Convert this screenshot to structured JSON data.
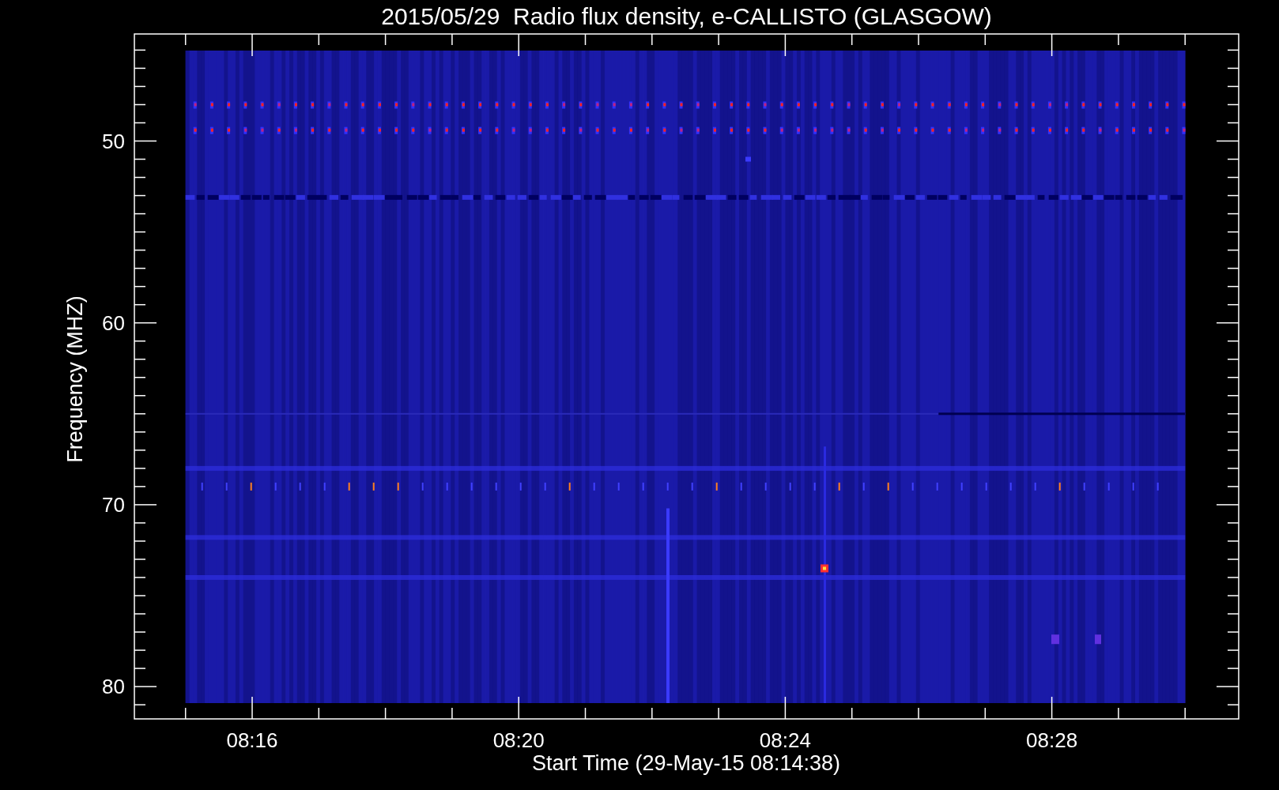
{
  "title": "2015/05/29  Radio flux density, e-CALLISTO (GLASGOW)",
  "y_axis": {
    "title": "Frequency (MHZ)",
    "tick_labels": [
      "50",
      "60",
      "70",
      "80"
    ]
  },
  "x_axis": {
    "title": "Start Time (29-May-15 08:14:38)",
    "tick_labels": [
      "08:16",
      "08:20",
      "08:24",
      "08:28"
    ]
  }
}
